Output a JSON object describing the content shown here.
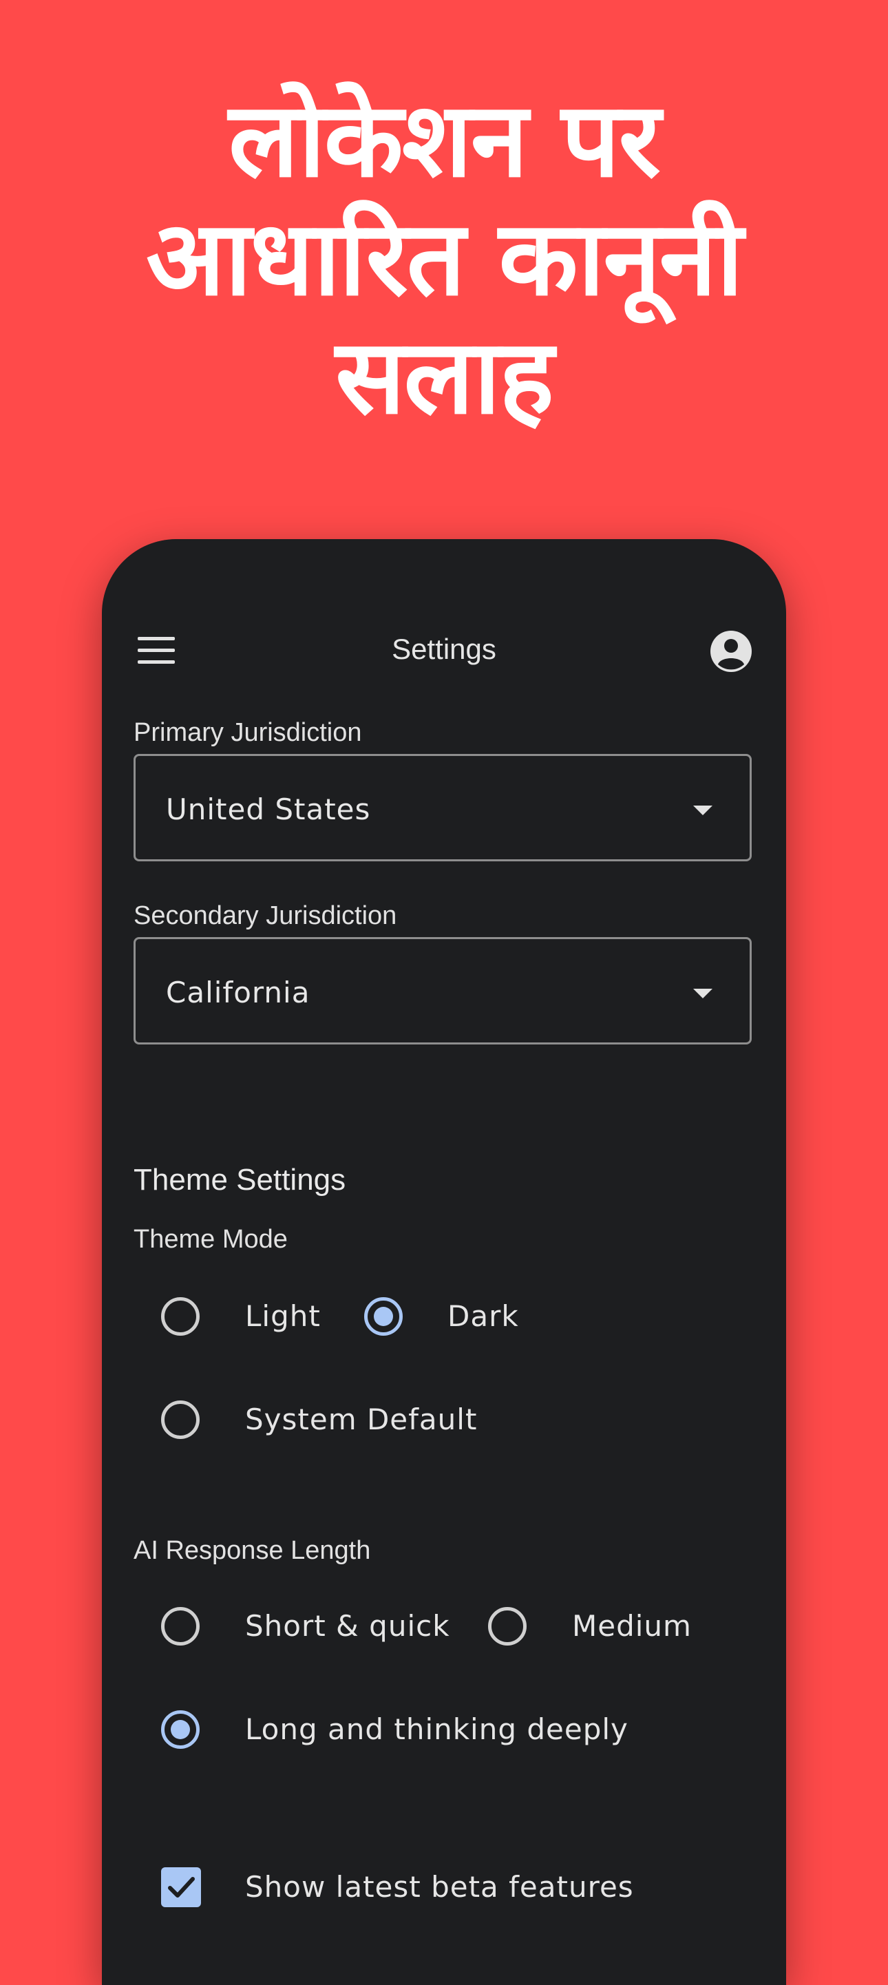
{
  "headline": {
    "line1": "लोकेशन पर",
    "line2": "आधारित कानूनी",
    "line3": "सलाह"
  },
  "appbar": {
    "title": "Settings",
    "menu_icon": "hamburger-menu-icon",
    "account_icon": "account-circle-icon"
  },
  "jurisdiction": {
    "primary_label": "Primary Jurisdiction",
    "primary_value": "United States",
    "secondary_label": "Secondary Jurisdiction",
    "secondary_value": "California"
  },
  "theme": {
    "section_title": "Theme Settings",
    "mode_label": "Theme Mode",
    "options": [
      {
        "label": "Light",
        "selected": false
      },
      {
        "label": "Dark",
        "selected": true
      },
      {
        "label": "System Default",
        "selected": false
      }
    ]
  },
  "response_length": {
    "label": "AI Response Length",
    "options": [
      {
        "label": "Short & quick",
        "selected": false
      },
      {
        "label": "Medium",
        "selected": false
      },
      {
        "label": "Long and thinking deeply",
        "selected": true
      }
    ]
  },
  "beta": {
    "label": "Show latest beta features",
    "checked": true
  },
  "colors": {
    "background": "#FF4A4A",
    "phone_surface": "#1D1E20",
    "accent": "#A9C7F5"
  }
}
